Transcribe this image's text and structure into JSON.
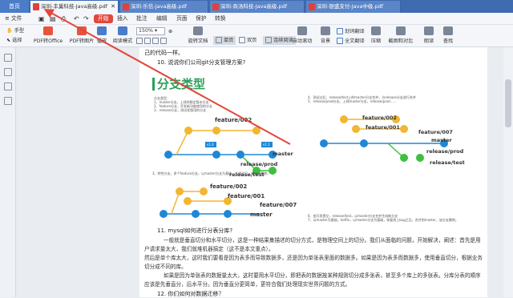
{
  "tabs": {
    "home": "首页",
    "docs": [
      {
        "label": "深圳-丰巢科技-Java高级.pdf"
      },
      {
        "label": "深圳-乐信-Java高级.pdf"
      },
      {
        "label": "深圳-商汤科技-Java高级.pdf"
      },
      {
        "label": "深圳-银盛支付-Java中级.pdf"
      }
    ]
  },
  "menu": {
    "file": "文件",
    "start": "开始",
    "insert": "插入",
    "annotate": "批注",
    "edit": "编辑",
    "page": "页面",
    "protect": "保护",
    "convert": "转换"
  },
  "ribbon": {
    "hand": "手型",
    "select": "选择",
    "pdf_to_office": "PDF转Office",
    "pdf_to_image": "PDF转图片",
    "play": "播放",
    "read_mode": "阅读模式",
    "zoom": "150%",
    "rotate": "旋转文档",
    "single_page": "单页",
    "double_page": "双页",
    "continuous": "连续阅读",
    "auto_scroll": "自动滚动",
    "background": "背景",
    "translate": "划词翻译",
    "full_translate": "全文翻译",
    "compress": "压缩",
    "screenshot_compare": "截图和对比",
    "read_aloud": "朗读",
    "search": "查找"
  },
  "document": {
    "line1": "己的代码一样。",
    "q10": "10. 说说你们公司git分支管理方案?",
    "heading": "分支类型",
    "note_left": "分支类型：\n1、master分支，上线的稳定版本分支\n2、feature分支，开发新功能使用的分支\n3、release分支，测试发版用的分支",
    "note_right": "4、测试过后，release/test上的master分支合并，与release分支进行合并\n5、release/prod分支，上线master分支，release/prod……",
    "labels": {
      "feature002": "feature/002",
      "feature001": "feature/001",
      "feature007": "feature/007",
      "master": "master",
      "release_prod": "release/prod",
      "release_test": "release/test",
      "v10": "v1.0",
      "v11": "v1.1"
    },
    "note_bottom_left": "3、特性分支，多个feature分支，以master分支为基础，上线之后，该分支删除。",
    "note_bottom_right": "6、由开发提交，release/test，以master分支合并生成新分支\n7、以master为基础，hotfix，以master分支为基础，修复线上bug之后，合并到master，该分支删除。",
    "q11": "11. mysql如何进行分表分库?",
    "p1": "一般就是垂直切分和水平切分，这是一种结果集描述的切分方式，是物理空间上的切分。我们从面临的问题，开始解决，阐述：首先是用户请求量太大，我们就堆机器搞定（这不是本文重点）。",
    "p2": "然后是单个库太大，这时我们要看是因为表多而导致数据多，还是因为单张表里面的数据多。如果是因为表多而数据多，使用垂直切分，根据业务切分成不同的库。",
    "p3": "如果是因为单张表的数据量太大，这时要用水平切分，即把表的数据按某种规则切分成多张表，甚至多个库上的多张表。分库分表的顺序应该是先垂直分，后水平分。因为垂直分更简单，更符合我们处理现实世界问题的方式。",
    "q12": "12. 你们如何对数据迁移？"
  },
  "colors": {
    "tabbar": "#3f6bb0",
    "accent_red": "#e2463c",
    "branch_yellow": "#f2b632",
    "branch_blue": "#1e88d6",
    "branch_green": "#3fbf3f",
    "heading_green": "#2e9e5b"
  }
}
